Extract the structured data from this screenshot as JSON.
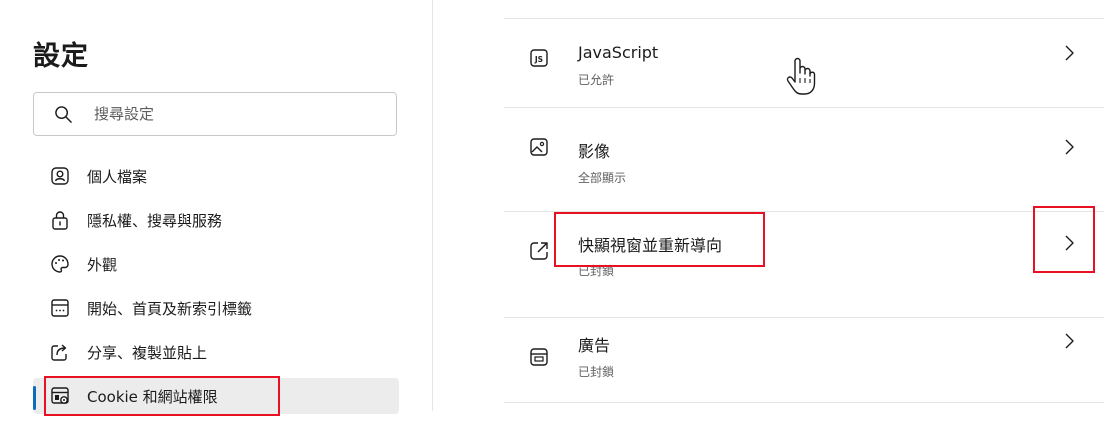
{
  "sidebar": {
    "title": "設定",
    "search": {
      "placeholder": "搜尋設定",
      "value": ""
    },
    "items": [
      {
        "label": "個人檔案",
        "icon": "profile-icon"
      },
      {
        "label": "隱私權、搜尋與服務",
        "icon": "lock-icon"
      },
      {
        "label": "外觀",
        "icon": "palette-icon"
      },
      {
        "label": "開始、首頁及新索引標籤",
        "icon": "home-tab-icon"
      },
      {
        "label": "分享、複製並貼上",
        "icon": "share-icon"
      },
      {
        "label": "Cookie 和網站權限",
        "icon": "site-permissions-icon",
        "active": true
      }
    ]
  },
  "content": {
    "rows": [
      {
        "title": "JavaScript",
        "subtitle": "已允許",
        "icon": "javascript-icon"
      },
      {
        "title": "影像",
        "subtitle": "全部顯示",
        "icon": "image-icon"
      },
      {
        "title": "快顯視窗並重新導向",
        "subtitle": "已封鎖",
        "icon": "popup-redirect-icon"
      },
      {
        "title": "廣告",
        "subtitle": "已封鎖",
        "icon": "ads-icon"
      }
    ]
  },
  "colors": {
    "accent": "#0f6cbd",
    "highlight": "#e81123",
    "active_bg": "#ececec"
  }
}
